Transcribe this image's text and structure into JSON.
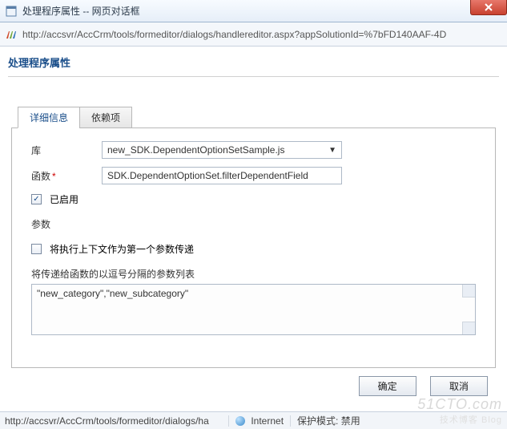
{
  "window": {
    "title": "处理程序属性 -- 网页对话框",
    "url": "http://accsvr/AccCrm/tools/formeditor/dialogs/handlereditor.aspx?appSolutionId=%7bFD140AAF-4D"
  },
  "section_title": "处理程序属性",
  "tabs": {
    "details": "详细信息",
    "deps": "依赖项"
  },
  "form": {
    "library_label": "库",
    "library_value": "new_SDK.DependentOptionSetSample.js",
    "function_label": "函数",
    "function_value": "SDK.DependentOptionSet.filterDependentField",
    "enabled_label": "已启用",
    "params_label": "参数",
    "pass_context_label": "将执行上下文作为第一个参数传递",
    "params_desc": "将传递给函数的以逗号分隔的参数列表",
    "params_value": "\"new_category\",\"new_subcategory\""
  },
  "buttons": {
    "ok": "确定",
    "cancel": "取消"
  },
  "status": {
    "url": "http://accsvr/AccCrm/tools/formeditor/dialogs/ha",
    "zone": "Internet",
    "protected": "保护模式: 禁用"
  },
  "watermark": {
    "main": "51CTO.com",
    "sub": "技术博客   Blog"
  }
}
